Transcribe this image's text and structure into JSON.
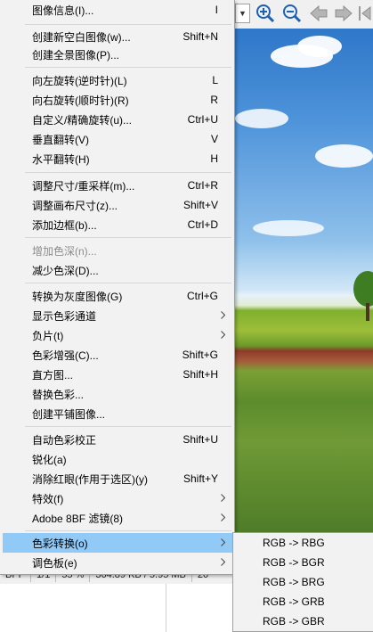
{
  "toolbar": {
    "icons": [
      "combo-dropdown-icon",
      "zoom-in-icon",
      "zoom-out-icon",
      "back-arrow-icon",
      "forward-arrow-icon",
      "next-icon"
    ],
    "colors": {
      "zoom": "#1f5fb0",
      "arrow": "#9a9a9a"
    }
  },
  "statusbar": {
    "cells": [
      "BPP",
      "1/1",
      "55 %",
      "364.89 KB / 5.95 MB",
      "20"
    ]
  },
  "menu": {
    "items": [
      {
        "label": "图像信息(I)...",
        "shortcut": "I",
        "disabled": false,
        "submenu": false
      },
      {
        "label": "创建新空白图像(w)...",
        "shortcut": "Shift+N",
        "disabled": false,
        "submenu": false
      },
      {
        "label": "创建全景图像(P)...",
        "shortcut": "",
        "disabled": false,
        "submenu": false
      },
      {
        "label": "向左旋转(逆时针)(L)",
        "shortcut": "L",
        "disabled": false,
        "submenu": false
      },
      {
        "label": "向右旋转(顺时针)(R)",
        "shortcut": "R",
        "disabled": false,
        "submenu": false
      },
      {
        "label": "自定义/精确旋转(u)...",
        "shortcut": "Ctrl+U",
        "disabled": false,
        "submenu": false
      },
      {
        "label": "垂直翻转(V)",
        "shortcut": "V",
        "disabled": false,
        "submenu": false
      },
      {
        "label": "水平翻转(H)",
        "shortcut": "H",
        "disabled": false,
        "submenu": false
      },
      {
        "label": "调整尺寸/重采样(m)...",
        "shortcut": "Ctrl+R",
        "disabled": false,
        "submenu": false
      },
      {
        "label": "调整画布尺寸(z)...",
        "shortcut": "Shift+V",
        "disabled": false,
        "submenu": false
      },
      {
        "label": "添加边框(b)...",
        "shortcut": "Ctrl+D",
        "disabled": false,
        "submenu": false
      },
      {
        "label": "增加色深(n)...",
        "shortcut": "",
        "disabled": true,
        "submenu": false
      },
      {
        "label": "减少色深(D)...",
        "shortcut": "",
        "disabled": false,
        "submenu": false
      },
      {
        "label": "转换为灰度图像(G)",
        "shortcut": "Ctrl+G",
        "disabled": false,
        "submenu": false
      },
      {
        "label": "显示色彩通道",
        "shortcut": "",
        "disabled": false,
        "submenu": true
      },
      {
        "label": "负片(t)",
        "shortcut": "",
        "disabled": false,
        "submenu": true
      },
      {
        "label": "色彩增强(C)...",
        "shortcut": "Shift+G",
        "disabled": false,
        "submenu": false
      },
      {
        "label": "直方图...",
        "shortcut": "Shift+H",
        "disabled": false,
        "submenu": false
      },
      {
        "label": "替换色彩...",
        "shortcut": "",
        "disabled": false,
        "submenu": false
      },
      {
        "label": "创建平铺图像...",
        "shortcut": "",
        "disabled": false,
        "submenu": false
      },
      {
        "label": "自动色彩校正",
        "shortcut": "Shift+U",
        "disabled": false,
        "submenu": false
      },
      {
        "label": "锐化(a)",
        "shortcut": "",
        "disabled": false,
        "submenu": false
      },
      {
        "label": "消除红眼(作用于选区)(y)",
        "shortcut": "Shift+Y",
        "disabled": false,
        "submenu": false
      },
      {
        "label": "特效(f)",
        "shortcut": "",
        "disabled": false,
        "submenu": true
      },
      {
        "label": "Adobe 8BF 滤镜(8)",
        "shortcut": "",
        "disabled": false,
        "submenu": true
      },
      {
        "label": "色彩转换(o)",
        "shortcut": "",
        "disabled": false,
        "submenu": true,
        "highlighted": true
      },
      {
        "label": "调色板(e)",
        "shortcut": "",
        "disabled": false,
        "submenu": true
      }
    ],
    "highlight_color": "#91c9f7"
  },
  "submenu": {
    "items": [
      "RGB -> RBG",
      "RGB -> BGR",
      "RGB -> BRG",
      "RGB -> GRB",
      "RGB -> GBR"
    ]
  }
}
